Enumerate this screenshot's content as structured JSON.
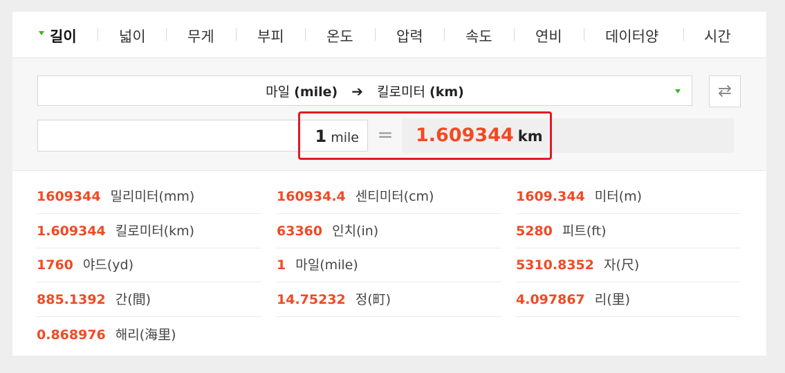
{
  "tabs": [
    {
      "label": "길이",
      "active": true
    },
    {
      "label": "넓이"
    },
    {
      "label": "무게"
    },
    {
      "label": "부피"
    },
    {
      "label": "온도"
    },
    {
      "label": "압력"
    },
    {
      "label": "속도"
    },
    {
      "label": "연비"
    },
    {
      "label": "데이터양"
    },
    {
      "label": "시간"
    }
  ],
  "converter": {
    "from_unit_name": "마일",
    "from_unit_code": "(mile)",
    "arrow": "➔",
    "to_unit_name": "킬로미터",
    "to_unit_code": "(km)",
    "swap_icon": "⇄",
    "input_value": "1",
    "input_unit": "mile",
    "equals": "=",
    "result_value": "1.609344",
    "result_unit": "km"
  },
  "results": [
    {
      "value": "1609344",
      "unit": "밀리미터(mm)"
    },
    {
      "value": "160934.4",
      "unit": "센티미터(cm)"
    },
    {
      "value": "1609.344",
      "unit": "미터(m)"
    },
    {
      "value": "1.609344",
      "unit": "킬로미터(km)"
    },
    {
      "value": "63360",
      "unit": "인치(in)"
    },
    {
      "value": "5280",
      "unit": "피트(ft)"
    },
    {
      "value": "1760",
      "unit": "야드(yd)"
    },
    {
      "value": "1",
      "unit": "마일(mile)"
    },
    {
      "value": "5310.8352",
      "unit": "자(尺)"
    },
    {
      "value": "885.1392",
      "unit": "간(間)"
    },
    {
      "value": "14.75232",
      "unit": "정(町)"
    },
    {
      "value": "4.097867",
      "unit": "리(里)"
    },
    {
      "value": "0.868976",
      "unit": "해리(海里)"
    }
  ],
  "colors": {
    "accent_green": "#3bb31c",
    "value_orange": "#f04a23",
    "highlight_red": "#e01a22"
  }
}
